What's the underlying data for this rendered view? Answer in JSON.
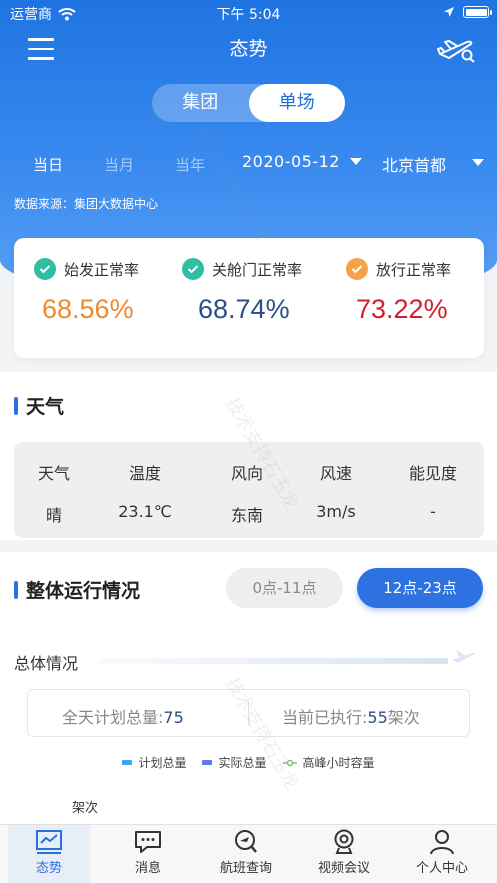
{
  "status": {
    "carrier": "运营商",
    "time": "下午 5:04"
  },
  "nav": {
    "title": "态势"
  },
  "segment": {
    "options": [
      "集团",
      "单场"
    ],
    "active_index": 1
  },
  "date_tabs": {
    "items": [
      "当日",
      "当月",
      "当年"
    ],
    "active_index": 0
  },
  "date": "2020-05-12",
  "airport": "北京首都",
  "source": "数据来源：集团大数据中心",
  "rates": [
    {
      "label": "始发正常率",
      "value": "68.56%",
      "icon_color": "#2fbfa0",
      "value_color": "#ee8a2c"
    },
    {
      "label": "关舱门正常率",
      "value": "68.74%",
      "icon_color": "#2fbfa0",
      "value_color": "#2b4f88"
    },
    {
      "label": "放行正常率",
      "value": "73.22%",
      "icon_color": "#f5a14a",
      "value_color": "#d1202c"
    }
  ],
  "weather": {
    "title": "天气",
    "columns": [
      {
        "label": "天气",
        "value": "晴"
      },
      {
        "label": "温度",
        "value": "23.1℃"
      },
      {
        "label": "风向",
        "value": "东南"
      },
      {
        "label": "风速",
        "value": "3m/s"
      },
      {
        "label": "能见度",
        "value": "-"
      }
    ]
  },
  "operation": {
    "title": "整体运行情况",
    "ranges": [
      "0点-11点",
      "12点-23点"
    ],
    "active_range": 1,
    "subtitle": "总体情况",
    "plan_label": "全天计划总量:",
    "plan_value": "75",
    "exec_label": "当前已执行:",
    "exec_value": "55",
    "exec_unit": "架次",
    "legend": [
      {
        "name": "计划总量",
        "color": "#3aa6e8"
      },
      {
        "name": "实际总量",
        "color": "#5b7de0"
      },
      {
        "name": "高峰小时容量",
        "color": "#7cc96a"
      }
    ],
    "y_unit": "架次"
  },
  "tabbar": {
    "items": [
      {
        "label": "态势",
        "icon": "chart-icon"
      },
      {
        "label": "消息",
        "icon": "message-icon"
      },
      {
        "label": "航班查询",
        "icon": "search-icon"
      },
      {
        "label": "视频会议",
        "icon": "camera-icon"
      },
      {
        "label": "个人中心",
        "icon": "person-icon"
      }
    ],
    "active_index": 0
  },
  "watermark": "技术支持石玉龙"
}
